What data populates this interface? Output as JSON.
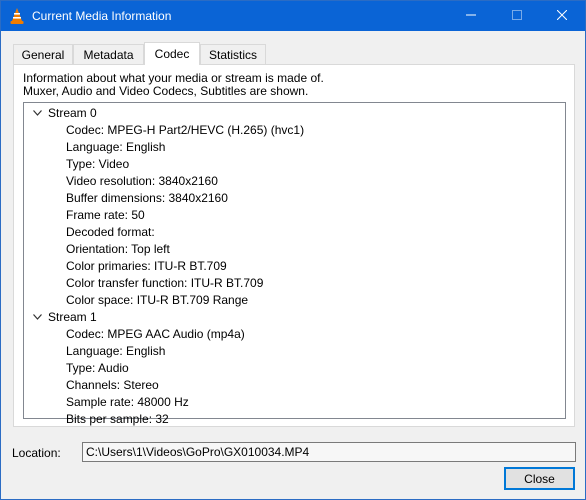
{
  "window": {
    "title": "Current Media Information"
  },
  "tabs": [
    {
      "label": "General",
      "active": false
    },
    {
      "label": "Metadata",
      "active": false
    },
    {
      "label": "Codec",
      "active": true
    },
    {
      "label": "Statistics",
      "active": false
    }
  ],
  "codec": {
    "description_line1": "Information about what your media or stream is made of.",
    "description_line2": "Muxer, Audio and Video Codecs, Subtitles are shown.",
    "streams": [
      {
        "label": "Stream 0",
        "expanded": true,
        "properties": [
          "Codec: MPEG-H Part2/HEVC (H.265) (hvc1)",
          "Language: English",
          "Type: Video",
          "Video resolution: 3840x2160",
          "Buffer dimensions: 3840x2160",
          "Frame rate: 50",
          "Decoded format:",
          "Orientation: Top left",
          "Color primaries: ITU-R BT.709",
          "Color transfer function: ITU-R BT.709",
          "Color space: ITU-R BT.709 Range"
        ]
      },
      {
        "label": "Stream 1",
        "expanded": true,
        "properties": [
          "Codec: MPEG AAC Audio (mp4a)",
          "Language: English",
          "Type: Audio",
          "Channels: Stereo",
          "Sample rate: 48000 Hz",
          "Bits per sample: 32"
        ]
      }
    ]
  },
  "location": {
    "label": "Location:",
    "value": "C:\\Users\\1\\Videos\\GoPro\\GX010034.MP4"
  },
  "buttons": {
    "close_label": "Close"
  },
  "colors": {
    "titlebar": "#0a64d6",
    "accent": "#0078d7",
    "vlc_cone": "#f07c00"
  },
  "icons": {
    "app": "vlc-cone-icon",
    "minimize": "minimize-icon",
    "maximize": "maximize-icon",
    "close": "close-icon",
    "expand": "chevron-down-icon"
  }
}
